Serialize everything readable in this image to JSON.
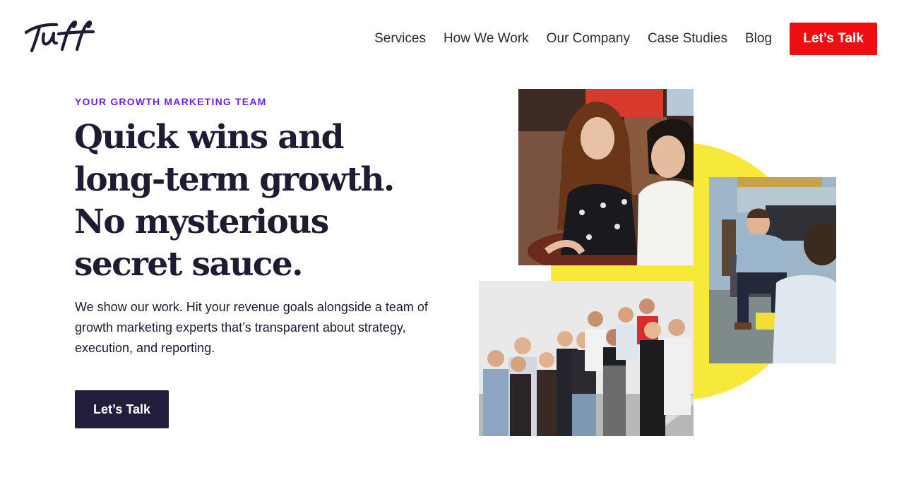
{
  "header": {
    "logo_text": "Tuff",
    "nav": [
      {
        "label": "Services"
      },
      {
        "label": "How We Work"
      },
      {
        "label": "Our Company"
      },
      {
        "label": "Case Studies"
      },
      {
        "label": "Blog"
      }
    ],
    "cta_label": "Let’s Talk"
  },
  "hero": {
    "eyebrow": "YOUR GROWTH MARKETING TEAM",
    "headline": "Quick wins and long-term growth. No mysterious secret sauce.",
    "body": "We show our work. Hit your revenue goals alongside a team of growth marketing experts that’s transparent about strategy, execution, and reporting.",
    "cta_label": "Let’s Talk"
  },
  "colors": {
    "accent_red": "#ef0d12",
    "eyebrow_purple": "#6a20f0",
    "navy": "#211d3a",
    "yellow": "#f7e93a"
  },
  "icons": {
    "logo": "tuff-script-logo"
  }
}
